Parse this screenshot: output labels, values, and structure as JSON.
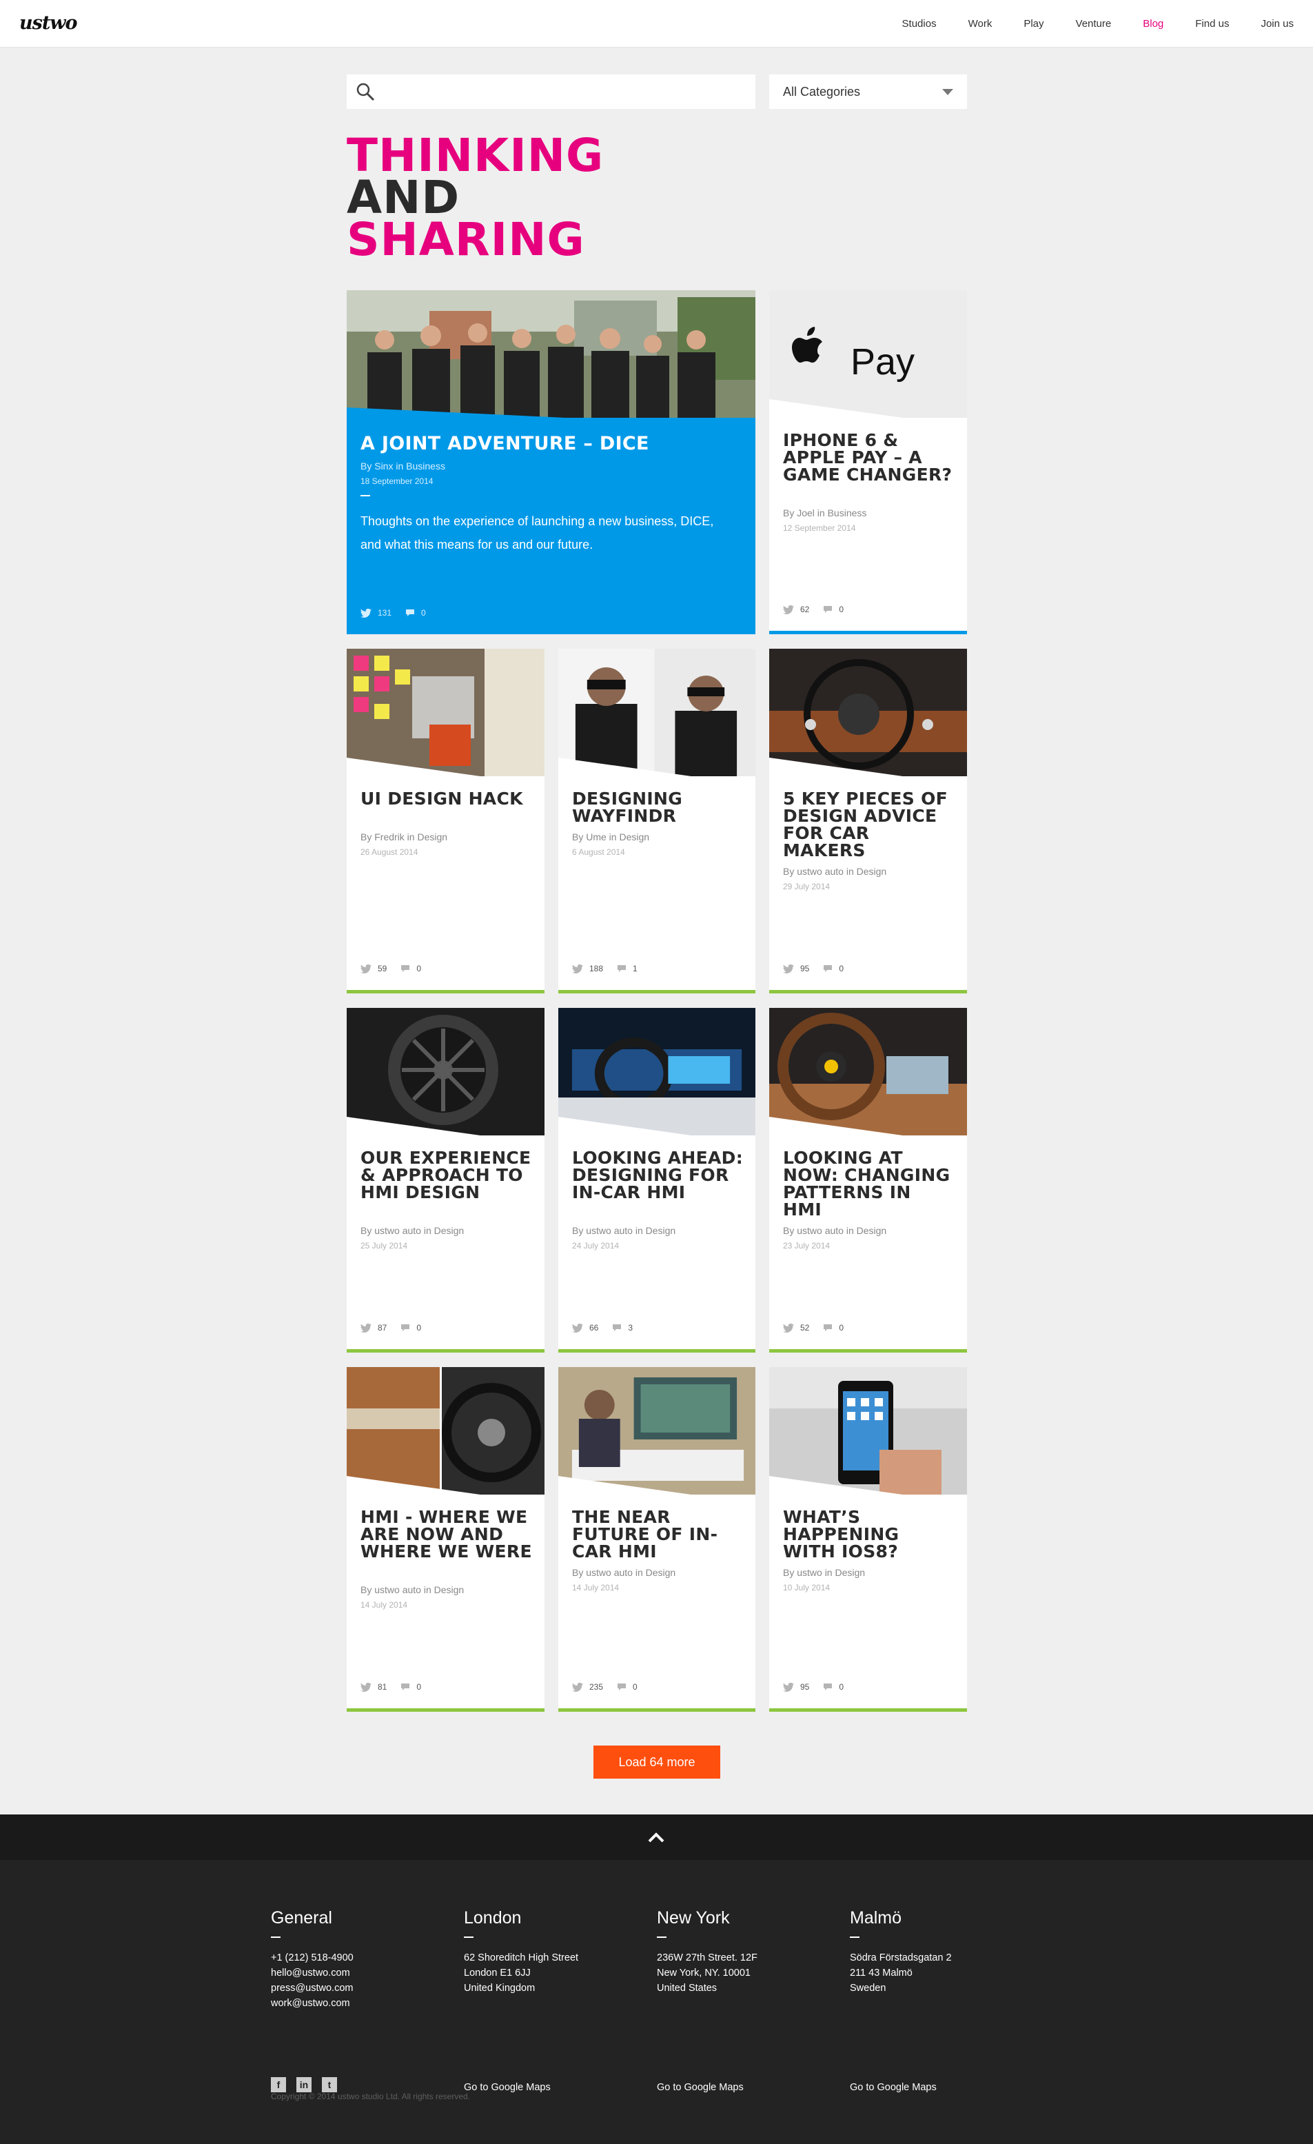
{
  "header": {
    "logo": "ustwo",
    "nav": [
      "Studios",
      "Work",
      "Play",
      "Venture",
      "Blog",
      "Find us",
      "Join us"
    ],
    "active_nav": "Blog"
  },
  "search": {
    "placeholder": "",
    "value": "",
    "icon": "search-icon"
  },
  "category_select": {
    "selected": "All Categories"
  },
  "headline": {
    "line1": "THINKING",
    "line2": "AND",
    "line3": "SHARING"
  },
  "colors": {
    "pink": "#e6007e",
    "blue": "#0099e8",
    "green": "#8dc63f",
    "orange": "#ff4f0f"
  },
  "featured": {
    "title": "A JOINT ADVENTURE – DICE",
    "byline": "By Sinx in Business",
    "date": "18 September 2014",
    "excerpt": "Thoughts on the experience of launching a new business, DICE, and what this means for us and our future.",
    "tweets": "131",
    "comments": "0"
  },
  "posts": [
    {
      "title": "IPHONE 6 & APPLE PAY – A GAME CHANGER?",
      "byline": "By Joel in Business",
      "date": "12 September 2014",
      "tweets": "62",
      "comments": "0"
    },
    {
      "title": "UI DESIGN HACK",
      "byline": "By Fredrik in Design",
      "date": "26 August 2014",
      "tweets": "59",
      "comments": "0"
    },
    {
      "title": "DESIGNING WAYFINDR",
      "byline": "By Ume in Design",
      "date": "6 August 2014",
      "tweets": "188",
      "comments": "1"
    },
    {
      "title": "5 KEY PIECES OF DESIGN ADVICE FOR CAR MAKERS",
      "byline": "By ustwo auto in Design",
      "date": "29 July 2014",
      "tweets": "95",
      "comments": "0"
    },
    {
      "title": "OUR EXPERIENCE & APPROACH TO HMI DESIGN",
      "byline": "By ustwo auto in Design",
      "date": "25 July 2014",
      "tweets": "87",
      "comments": "0"
    },
    {
      "title": "LOOKING AHEAD: DESIGNING FOR IN-CAR HMI",
      "byline": "By ustwo auto in Design",
      "date": "24 July 2014",
      "tweets": "66",
      "comments": "3"
    },
    {
      "title": "LOOKING AT NOW: CHANGING PATTERNS IN HMI",
      "byline": "By ustwo auto in Design",
      "date": "23 July 2014",
      "tweets": "52",
      "comments": "0"
    },
    {
      "title": "HMI - WHERE WE ARE NOW AND WHERE WE WERE",
      "byline": "By ustwo auto in Design",
      "date": "14 July 2014",
      "tweets": "81",
      "comments": "0"
    },
    {
      "title": "THE NEAR FUTURE OF IN-CAR HMI",
      "byline": "By ustwo auto in Design",
      "date": "14 July 2014",
      "tweets": "235",
      "comments": "0"
    },
    {
      "title": "WHAT’S HAPPENING WITH IOS8?",
      "byline": "By ustwo in Design",
      "date": "10 July 2014",
      "tweets": "95",
      "comments": "0"
    }
  ],
  "apple_pay_logo_text": "Pay",
  "load_more": "Load 64 more",
  "footer": {
    "general": {
      "title": "General",
      "lines": [
        "+1 (212) 518-4900",
        "hello@ustwo.com",
        "press@ustwo.com",
        "work@ustwo.com"
      ]
    },
    "london": {
      "title": "London",
      "lines": [
        "62 Shoreditch High Street",
        "London E1 6JJ",
        "United Kingdom"
      ],
      "maps": "Go to Google Maps"
    },
    "newyork": {
      "title": "New York",
      "lines": [
        "236W 27th Street. 12F",
        "New York, NY. 10001",
        "United States"
      ],
      "maps": "Go to Google Maps"
    },
    "malmo": {
      "title": "Malmö",
      "lines": [
        "Södra Förstadsgatan 2",
        "211 43 Malmö",
        "Sweden"
      ],
      "maps": "Go to Google Maps"
    },
    "social": [
      "facebook-icon",
      "linkedin-icon",
      "twitter-icon"
    ],
    "copyright": "Copyright © 2014 ustwo studio Ltd. All rights reserved."
  }
}
